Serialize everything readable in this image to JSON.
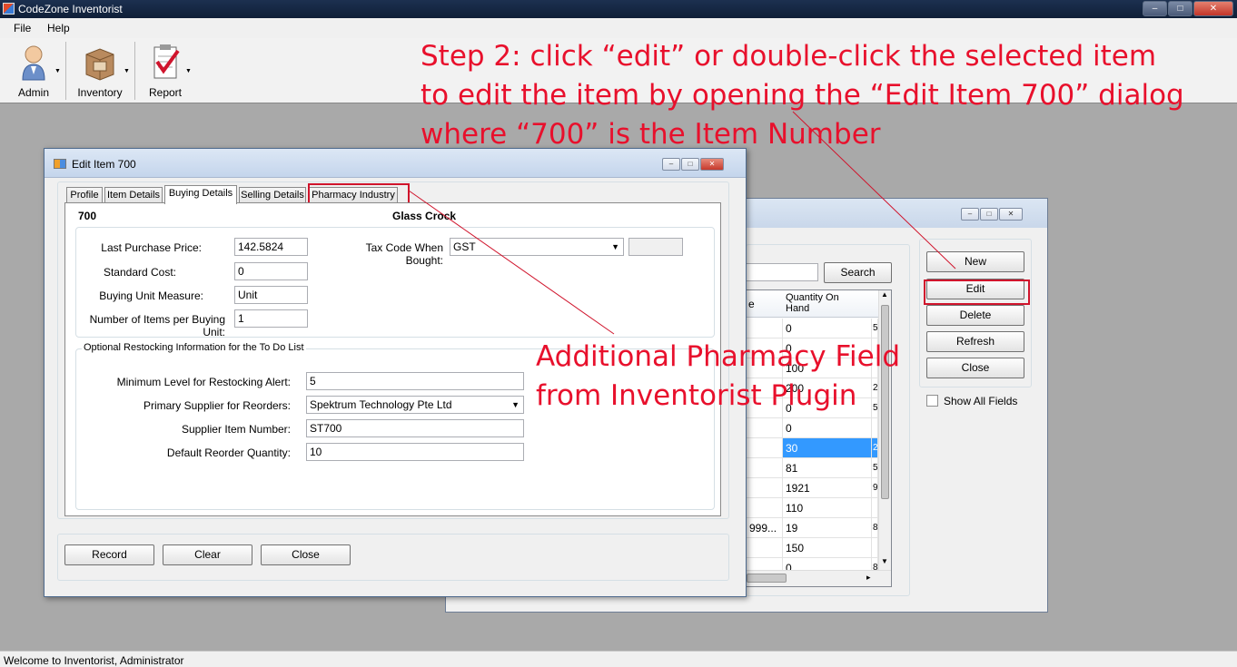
{
  "app": {
    "title": "CodeZone Inventorist",
    "window_buttons": [
      "‒",
      "□",
      "✕"
    ]
  },
  "menu": [
    "File",
    "Help"
  ],
  "toolbar": [
    {
      "label": "Admin",
      "icon": "admin-user-icon"
    },
    {
      "label": "Inventory",
      "icon": "inventory-box-icon"
    },
    {
      "label": "Report",
      "icon": "report-checklist-icon"
    }
  ],
  "annotations": {
    "step2_line1": "Step 2: click “edit” or double-click the selected item",
    "step2_line2": "to edit the item by opening the “Edit Item 700” dialog",
    "step2_line3": "where “700” is the Item Number",
    "pharmacy_line1": "Additional Pharmacy Field",
    "pharmacy_line2": "from Inventorist Plugin",
    "color": "#e8102c"
  },
  "inventory_window": {
    "search_button": "Search",
    "buttons": [
      "New",
      "Edit",
      "Delete",
      "Refresh",
      "Close"
    ],
    "show_all_fields": "Show All Fields",
    "grid_header_left": "e",
    "grid_header": "Quantity On\nHand",
    "left_col_values": [
      "",
      "",
      "",
      "",
      "",
      "",
      "",
      "",
      "",
      "",
      "999...",
      ""
    ],
    "quantities": [
      "0",
      "0",
      "100",
      "200",
      "0",
      "0",
      "30",
      "81",
      "1921",
      "110",
      "19",
      "150",
      "0"
    ],
    "right_col_values": [
      "5",
      "",
      "",
      "2",
      "5",
      "",
      "2",
      "5",
      "9",
      "",
      "8",
      "",
      "8"
    ],
    "selected_row_index": 6
  },
  "edit_dialog": {
    "title": "Edit Item 700",
    "tabs": [
      "Profile",
      "Item Details",
      "Buying Details",
      "Selling Details",
      "Pharmacy Industry"
    ],
    "active_tab": "Buying Details",
    "item_number": "700",
    "item_name": "Glass Crock",
    "fields": {
      "last_purchase_price_label": "Last Purchase Price:",
      "last_purchase_price": "142.5824",
      "standard_cost_label": "Standard Cost:",
      "standard_cost": "0",
      "buying_unit_label": "Buying Unit Measure:",
      "buying_unit": "Unit",
      "items_per_unit_label": "Number of  Items per Buying Unit:",
      "items_per_unit": "1",
      "tax_code_label": "Tax Code When Bought:",
      "tax_code": "GST",
      "tax_rate": ""
    },
    "restock": {
      "section_title": "Optional Restocking Information for the To Do List",
      "min_level_label": "Minimum Level for Restocking Alert:",
      "min_level": "5",
      "supplier_label": "Primary Supplier for Reorders:",
      "supplier": "Spektrum Technology Pte Ltd",
      "supplier_item_label": "Supplier Item Number:",
      "supplier_item": "ST700",
      "reorder_qty_label": "Default Reorder Quantity:",
      "reorder_qty": "10"
    },
    "buttons": [
      "Record",
      "Clear",
      "Close"
    ]
  },
  "status": "Welcome to Inventorist, Administrator"
}
